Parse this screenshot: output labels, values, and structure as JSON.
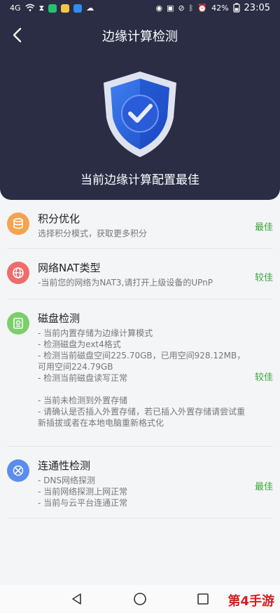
{
  "statusbar": {
    "signal": "4G",
    "battery": "42%",
    "time": "23:05",
    "icons": [
      "wifi-icon",
      "hourglass-icon",
      "wechat-icon",
      "email-icon",
      "qq-icon",
      "cloud-icon",
      "eye-icon",
      "nfc-icon",
      "mute-icon",
      "bluetooth-icon",
      "alarm-icon",
      "battery-icon"
    ]
  },
  "header": {
    "title": "边缘计算检测",
    "result": "当前边缘计算配置最佳",
    "shield_icon": "shield-check-icon",
    "back_icon": "back-arrow-icon",
    "bg_color": "#2b2d45"
  },
  "items": [
    {
      "title": "积分优化",
      "desc": "选择积分模式，获取更多积分",
      "status": "最佳",
      "icon": "database-icon",
      "icon_color": "#f7a24d"
    },
    {
      "title": "网络NAT类型",
      "desc": "-当前您的网络为NAT3,请打开上级设备的UPnP",
      "status": "较佳",
      "icon": "globe-icon",
      "icon_color": "#f06b6b"
    },
    {
      "title": "磁盘检测",
      "desc": " - 当前内置存储为边缘计算模式\n   - 检测磁盘为ext4格式\n   - 检测当前磁盘空间225.70GB，已用空间928.12MB，可用空间224.79GB\n   - 检测当前磁盘读写正常\n\n - 当前未检测到外置存储\n   - 请确认是否插入外置存储，若已插入外置存储请尝试重新插拔或者在本地电脑重新格式化",
      "status": "较佳",
      "icon": "disk-icon",
      "icon_color": "#7ccf6a"
    },
    {
      "title": "连通性检测",
      "desc": " - DNS网络探测\n   - 当前网络探测上网正常\n   - 当前与云平台连通正常",
      "status": "最佳",
      "icon": "link-icon",
      "icon_color": "#5b8def"
    }
  ],
  "navbar": {
    "back_icon": "nav-back-icon",
    "home_icon": "nav-home-icon",
    "recents_icon": "nav-recents-icon"
  },
  "watermark": "第4手游"
}
